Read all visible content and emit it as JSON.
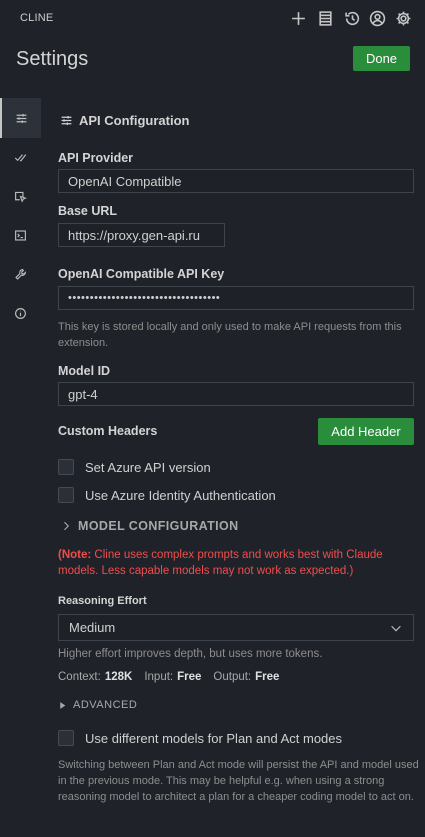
{
  "topbar": {
    "title": "CLINE",
    "icons": [
      "plus-icon",
      "history-list-icon",
      "history-icon",
      "account-icon",
      "settings-icon"
    ]
  },
  "header": {
    "title": "Settings",
    "done_label": "Done"
  },
  "sidebar": {
    "items": [
      {
        "name": "api-configuration",
        "icon": "sliders-icon",
        "active": true
      },
      {
        "name": "features",
        "icon": "check-double-icon"
      },
      {
        "name": "browser",
        "icon": "cursor-icon"
      },
      {
        "name": "terminal",
        "icon": "terminal-icon"
      },
      {
        "name": "debug",
        "icon": "wrench-icon"
      },
      {
        "name": "about",
        "icon": "info-icon"
      }
    ]
  },
  "section": {
    "title": "API Configuration",
    "icon": "sliders-icon"
  },
  "form": {
    "api_provider_label": "API Provider",
    "api_provider_value": "OpenAI Compatible",
    "base_url_label": "Base URL",
    "base_url_value": "https://proxy.gen-api.ru",
    "api_key_label": "OpenAI Compatible API Key",
    "api_key_value": "•••••••••••••••••••••••••••••••••••",
    "api_key_hint": "This key is stored locally and only used to make API requests from this extension.",
    "model_id_label": "Model ID",
    "model_id_value": "gpt-4",
    "custom_headers_label": "Custom Headers",
    "add_header_label": "Add Header",
    "azure_version_label": "Set Azure API version",
    "azure_identity_label": "Use Azure Identity Authentication",
    "model_config_label": "MODEL CONFIGURATION",
    "note_prefix": "(Note:",
    "note_text": " Cline uses complex prompts and works best with Claude models. Less capable models may not work as expected.)",
    "reasoning_label": "Reasoning Effort",
    "reasoning_value": "Medium",
    "reasoning_hint": "Higher effort improves depth, but uses more tokens.",
    "context_label": "Context:",
    "context_value": "128K",
    "input_label": "Input:",
    "input_value": "Free",
    "output_label": "Output:",
    "output_value": "Free",
    "advanced_label": "ADVANCED",
    "plan_act_label": "Use different models for Plan and Act modes",
    "plan_act_hint": "Switching between Plan and Act mode will persist the API and model used in the previous mode. This may be helpful e.g. when using a strong reasoning model to architect a plan for a cheaper coding model to act on."
  },
  "colors": {
    "accent_green": "#2a8d3c",
    "warning_red": "#f14c4c",
    "background": "#1f2329"
  }
}
